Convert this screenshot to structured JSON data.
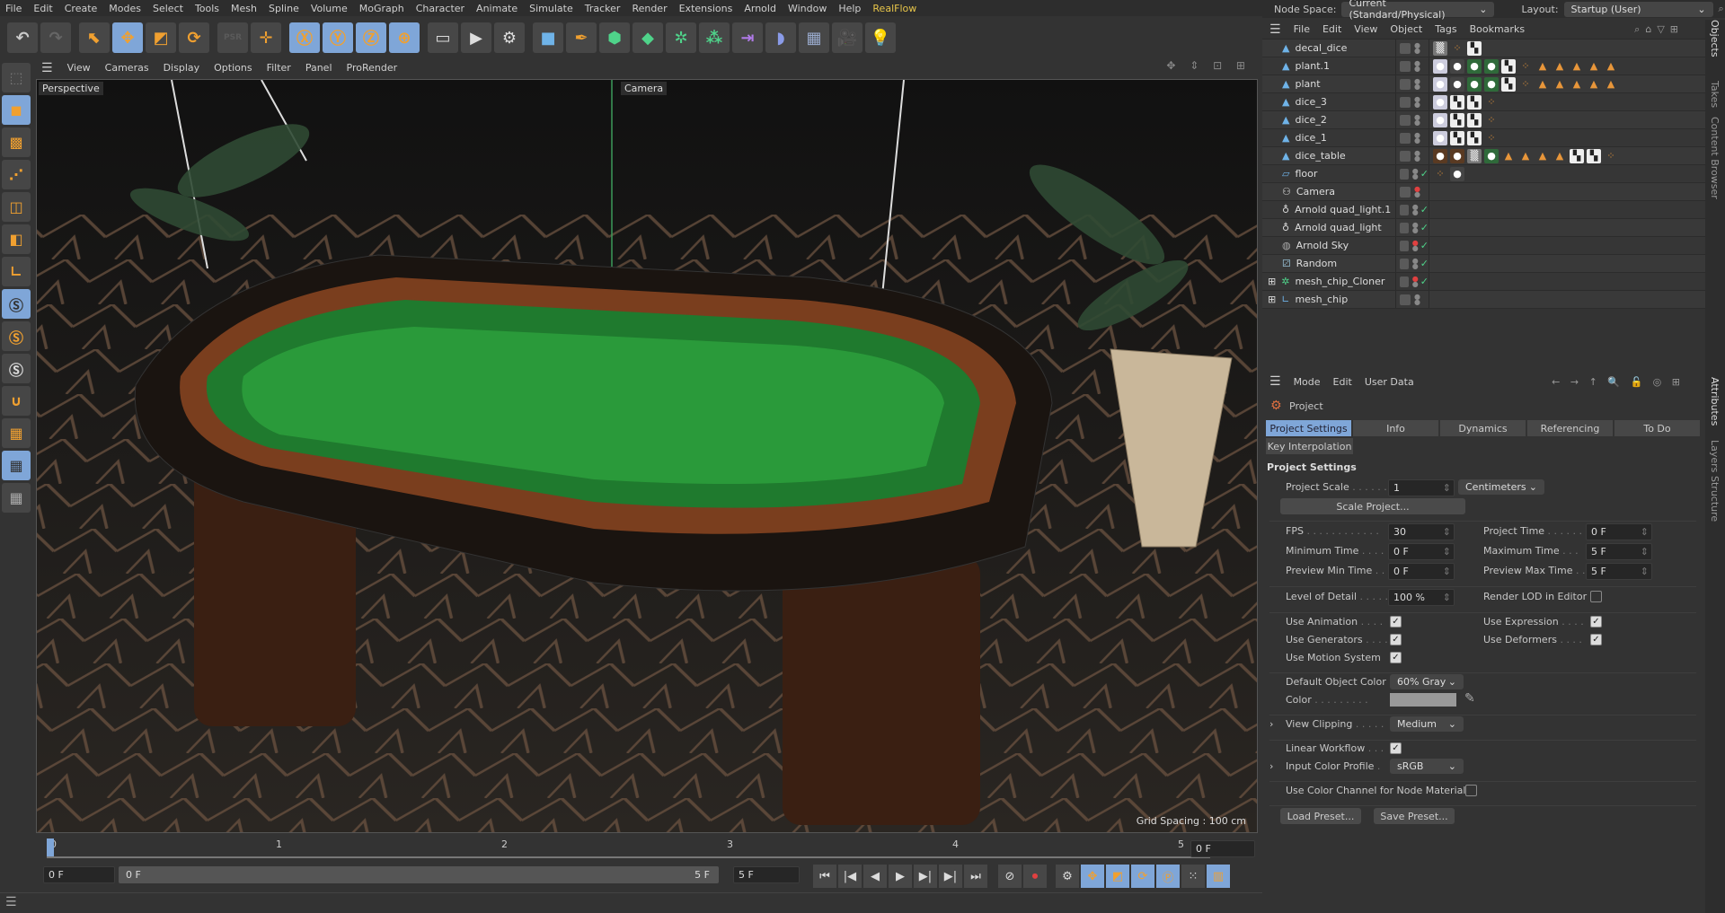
{
  "menubar": [
    "File",
    "Edit",
    "Create",
    "Modes",
    "Select",
    "Tools",
    "Mesh",
    "Spline",
    "Volume",
    "MoGraph",
    "Character",
    "Animate",
    "Simulate",
    "Tracker",
    "Render",
    "Extensions",
    "Arnold",
    "Window",
    "Help",
    "RealFlow"
  ],
  "toolbar": [
    {
      "name": "undo-icon",
      "g": "↶",
      "c": "#ccc"
    },
    {
      "name": "redo-icon",
      "g": "↷",
      "c": "#666"
    },
    {
      "name": "select-icon",
      "g": "⬉",
      "gap": true
    },
    {
      "name": "move-icon",
      "g": "✥",
      "on": true
    },
    {
      "name": "scale-icon",
      "g": "◩"
    },
    {
      "name": "rotate-icon",
      "g": "⟳"
    },
    {
      "name": "psr-icon",
      "g": "PSR",
      "dim": true,
      "gap": true
    },
    {
      "name": "world-move-icon",
      "g": "✛"
    },
    {
      "name": "x-axis-icon",
      "g": "Ⓧ",
      "on": true,
      "gap": true
    },
    {
      "name": "y-axis-icon",
      "g": "Ⓨ",
      "on": true
    },
    {
      "name": "z-axis-icon",
      "g": "Ⓩ",
      "on": true
    },
    {
      "name": "coord-system-icon",
      "g": "⊕",
      "on": true
    },
    {
      "name": "render-view-icon",
      "g": "▭",
      "c": "#ddd",
      "gap": true
    },
    {
      "name": "render-picture-viewer-icon",
      "g": "▶",
      "c": "#ddd"
    },
    {
      "name": "render-settings-icon",
      "g": "⚙",
      "c": "#ddd"
    },
    {
      "name": "cube-icon",
      "g": "■",
      "c": "#6fb3e8",
      "gap": true
    },
    {
      "name": "pen-icon",
      "g": "✒"
    },
    {
      "name": "generator-icon",
      "g": "⬢",
      "c": "#4fd38a"
    },
    {
      "name": "subdivision-icon",
      "g": "◆",
      "c": "#4fd38a"
    },
    {
      "name": "mograph-icon",
      "g": "✲",
      "c": "#4fd38a"
    },
    {
      "name": "cloner-icon",
      "g": "⁂",
      "c": "#4fd38a"
    },
    {
      "name": "deformer-icon",
      "g": "⇥",
      "c": "#b07ae8"
    },
    {
      "name": "field-icon",
      "g": "◗",
      "c": "#8a9be8"
    },
    {
      "name": "floor-icon",
      "g": "▦",
      "c": "#9ac"
    },
    {
      "name": "camera-icon",
      "g": "🎥",
      "c": "#ddd"
    },
    {
      "name": "light-icon",
      "g": "💡",
      "c": "#ddd"
    }
  ],
  "lefttools": [
    {
      "name": "make-editable-icon",
      "g": "⬚",
      "c": "#777"
    },
    {
      "name": "model-mode-icon",
      "g": "◼",
      "on": true
    },
    {
      "name": "texture-mode-icon",
      "g": "▩"
    },
    {
      "name": "points-mode-icon",
      "g": "⋰"
    },
    {
      "name": "edges-mode-icon",
      "g": "◫"
    },
    {
      "name": "polygons-mode-icon",
      "g": "◧"
    },
    {
      "name": "axis-mode-icon",
      "g": "∟"
    },
    {
      "name": "solo-icon",
      "g": "Ⓢ",
      "on": true,
      "c": "#333"
    },
    {
      "name": "solo-hierarchy-icon",
      "g": "Ⓢ"
    },
    {
      "name": "solo-off-icon",
      "g": "Ⓢ",
      "c": "#ddd"
    },
    {
      "name": "snap-icon",
      "g": "∪"
    },
    {
      "name": "workplane-icon",
      "g": "▦"
    },
    {
      "name": "lock-workplane-icon",
      "g": "▦",
      "on": true,
      "c": "#333"
    },
    {
      "name": "workplane-align-icon",
      "g": "▦",
      "c": "#aaa"
    }
  ],
  "viewport": {
    "menu": [
      "View",
      "Cameras",
      "Display",
      "Options",
      "Filter",
      "Panel",
      "ProRender"
    ],
    "label": "Perspective",
    "camera_label": "Camera",
    "grid_spacing": "Grid Spacing : 100 cm",
    "icons": "✥ ⇕ ⊡ ⊞"
  },
  "timeline": {
    "ticks": [
      "0",
      "1",
      "2",
      "3",
      "4",
      "5"
    ],
    "current": "0 F",
    "start": "0 F",
    "range_start": "0 F",
    "range_end": "5 F",
    "end": "5 F"
  },
  "top_right": {
    "node_space_label": "Node Space:",
    "node_space": "Current (Standard/Physical)",
    "layout_label": "Layout:",
    "layout": "Startup (User)"
  },
  "objects": {
    "menu": [
      "File",
      "Edit",
      "View",
      "Object",
      "Tags",
      "Bookmarks"
    ],
    "rows": [
      {
        "name": "decal_dice",
        "icon": "▲",
        "ic": "#6fb3e8",
        "tags": [
          "tx",
          "ph",
          "ck"
        ]
      },
      {
        "name": "plant.1",
        "icon": "▲",
        "ic": "#6fb3e8",
        "tags": [
          "mw",
          "mk",
          "mg",
          "mg",
          "ck",
          "ph",
          "tr",
          "tr",
          "tr",
          "tr",
          "tr"
        ]
      },
      {
        "name": "plant",
        "icon": "▲",
        "ic": "#6fb3e8",
        "tags": [
          "mw",
          "mk",
          "mg",
          "mg",
          "ck",
          "ph",
          "tr",
          "tr",
          "tr",
          "tr",
          "tr"
        ]
      },
      {
        "name": "dice_3",
        "icon": "▲",
        "ic": "#6fb3e8",
        "tags": [
          "mw",
          "ck",
          "ck",
          "ph"
        ]
      },
      {
        "name": "dice_2",
        "icon": "▲",
        "ic": "#6fb3e8",
        "tags": [
          "mw",
          "ck",
          "ck",
          "ph"
        ]
      },
      {
        "name": "dice_1",
        "icon": "▲",
        "ic": "#6fb3e8",
        "tags": [
          "mw",
          "ck",
          "ck",
          "ph"
        ]
      },
      {
        "name": "dice_table",
        "icon": "▲",
        "ic": "#6fb3e8",
        "tags": [
          "mb",
          "mb",
          "tx",
          "mg",
          "tr",
          "tr",
          "tr",
          "tr",
          "ck",
          "ck",
          "ph"
        ]
      },
      {
        "name": "floor",
        "icon": "▱",
        "ic": "#6fb3e8",
        "tags": [
          "ph",
          "mk"
        ],
        "check": true
      },
      {
        "name": "Camera",
        "icon": "⚇",
        "ic": "#ddd",
        "tags": [],
        "red": true
      },
      {
        "name": "Arnold quad_light.1",
        "icon": "♁",
        "ic": "#ddd",
        "tags": [],
        "check": true
      },
      {
        "name": "Arnold quad_light",
        "icon": "♁",
        "ic": "#ddd",
        "tags": [],
        "check": true
      },
      {
        "name": "Arnold Sky",
        "icon": "◍",
        "ic": "#aaa",
        "tags": [],
        "check": true,
        "red": true
      },
      {
        "name": "Random",
        "icon": "⚂",
        "ic": "#8ab",
        "tags": [],
        "check": true
      },
      {
        "name": "mesh_chip_Cloner",
        "icon": "✲",
        "ic": "#4fd38a",
        "tags": [],
        "check": true,
        "red": true,
        "expand": true
      },
      {
        "name": "mesh_chip",
        "icon": "∟",
        "ic": "#6fb3e8",
        "tags": [],
        "expand": true
      }
    ]
  },
  "side_tabs": {
    "top": [
      "Objects",
      "Takes",
      "Content Browser"
    ],
    "bottom": [
      "Attributes",
      "Layers",
      "Structure"
    ]
  },
  "attributes": {
    "menu": [
      "Mode",
      "Edit",
      "User Data"
    ],
    "nav_icons": "← → ↑ 🔍 🔓 ◎ ⊞",
    "object": "Project",
    "tabs": [
      "Project Settings",
      "Info",
      "Dynamics",
      "Referencing",
      "To Do"
    ],
    "tab2": "Key Interpolation",
    "section": "Project Settings",
    "project_scale_label": "Project Scale",
    "project_scale": "1",
    "scale_unit": "Centimeters",
    "scale_project": "Scale Project...",
    "fps_label": "FPS",
    "fps": "30",
    "project_time_label": "Project Time",
    "project_time": "0 F",
    "min_time_label": "Minimum Time",
    "min_time": "0 F",
    "max_time_label": "Maximum Time",
    "max_time": "5 F",
    "prev_min_label": "Preview Min Time",
    "prev_min": "0 F",
    "prev_max_label": "Preview Max Time",
    "prev_max": "5 F",
    "lod_label": "Level of Detail",
    "lod": "100 %",
    "render_lod_label": "Render LOD in Editor",
    "use_animation_label": "Use Animation",
    "use_expression_label": "Use Expression",
    "use_generators_label": "Use Generators",
    "use_deformers_label": "Use Deformers",
    "use_motion_label": "Use Motion System",
    "default_color_label": "Default Object Color",
    "default_color": "60% Gray",
    "color_label": "Color",
    "color_value": "#999999",
    "view_clipping_label": "View Clipping",
    "view_clipping": "Medium",
    "linear_workflow_label": "Linear Workflow",
    "input_color_label": "Input Color Profile",
    "input_color": "sRGB",
    "node_material_label": "Use Color Channel for Node Material",
    "load_preset": "Load Preset...",
    "save_preset": "Save Preset..."
  },
  "colors": {
    "accent": "#7fa6d8",
    "orange": "#f0a030"
  }
}
